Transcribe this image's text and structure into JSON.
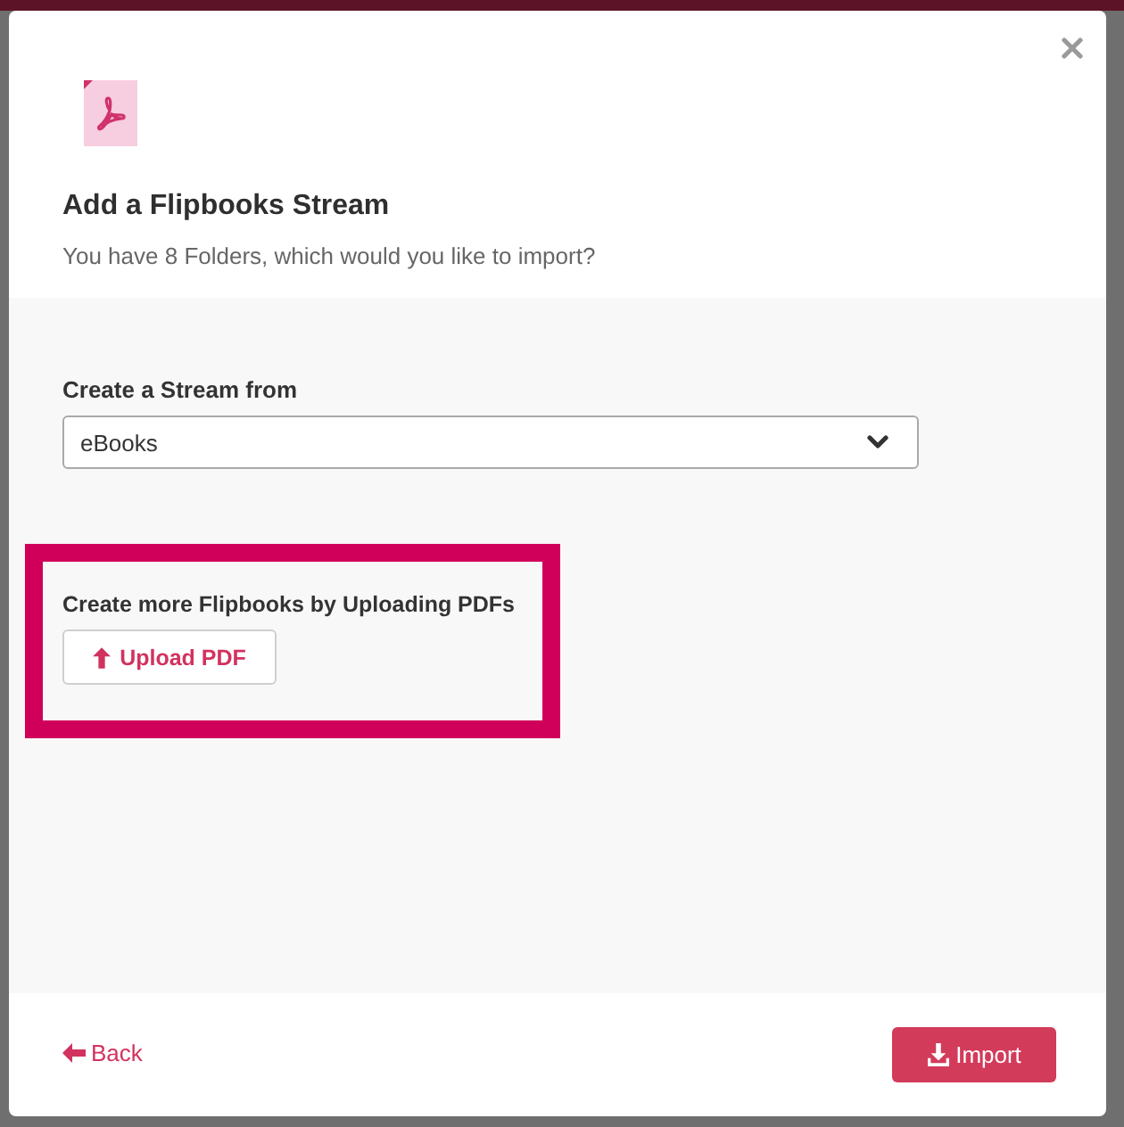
{
  "dialog": {
    "header": {
      "title": "Add a Flipbooks Stream",
      "subtitle": "You have 8 Folders, which would you like to import?"
    },
    "stream_source": {
      "label": "Create a Stream from",
      "value": "eBooks"
    },
    "upload": {
      "prompt": "Create more Flipbooks by Uploading PDFs",
      "button": "Upload PDF",
      "highlighted": true
    },
    "footer": {
      "back": "Back",
      "import": "Import"
    }
  }
}
